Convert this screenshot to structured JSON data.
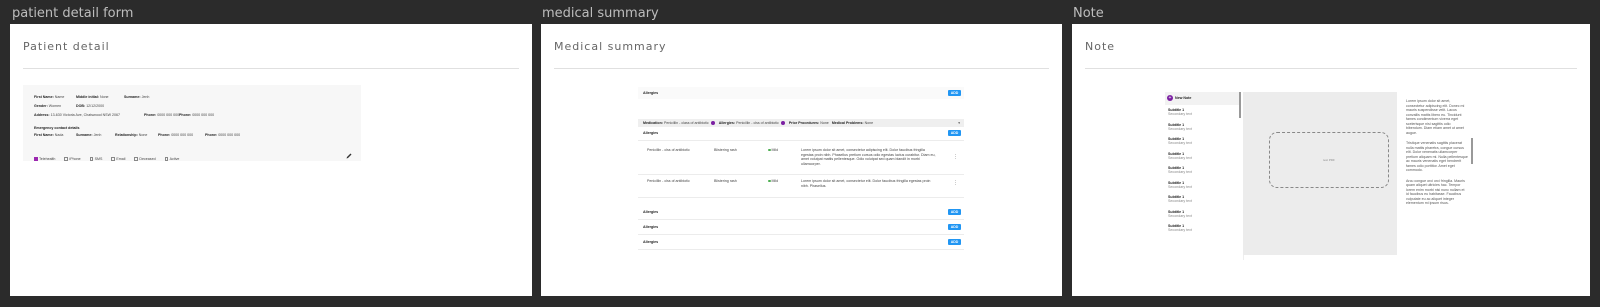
{
  "frames": {
    "patient": {
      "label": "patient detail form",
      "title": "Patient detail"
    },
    "medical": {
      "label": "medical summary",
      "title": "Medical summary"
    },
    "note": {
      "label": "Note",
      "title": "Note"
    }
  },
  "patient": {
    "first_name_label": "First Name:",
    "first_name": "Name",
    "middle_label": "Middle initial:",
    "middle": "None",
    "surname_label": "Surname:",
    "surname": "Jenh",
    "gender_label": "Gender:",
    "gender": "Women",
    "dob_label": "DOB:",
    "dob": "12/12/2000",
    "address_label": "Address:",
    "address": "13-630 Victoria Ave, Chatswood NSW 2067",
    "phone1_label": "Phone:",
    "phone1": "0000 000 000",
    "phone2_label": "Phone:",
    "phone2": "0000 000 000",
    "emergency_heading": "Emergency contact details",
    "ec_first_label": "First Name:",
    "ec_first": "Nada",
    "ec_surname_label": "Surname:",
    "ec_surname": "Jenh",
    "ec_rel_label": "Relationship:",
    "ec_rel": "None",
    "ec_phone1_label": "Phone:",
    "ec_phone1": "0000 000 000",
    "ec_phone2_label": "Phone:",
    "ec_phone2": "0000 000 000",
    "checks": [
      {
        "label": "Telehealth",
        "checked": true
      },
      {
        "label": "iPhone",
        "checked": false
      },
      {
        "label": "SMS",
        "checked": false
      },
      {
        "label": "Email",
        "checked": false
      },
      {
        "label": "Deceased",
        "checked": false
      },
      {
        "label": "Active",
        "checked": false
      }
    ],
    "edit_icon": "pencil-icon"
  },
  "medical": {
    "top_row": {
      "label": "Allergies",
      "button": "ADD"
    },
    "summary_bar": {
      "medication_label": "Medication:",
      "medication": "Penicillin - class of antibiotic",
      "allergies_label": "Allergies:",
      "allergies": "Penicillin - clss of antibiotic",
      "procedures_label": "Prior Procedures:",
      "procedures": "None",
      "problems_label": "Medical Problems:",
      "problems": "None"
    },
    "expanded": {
      "label": "Allergies",
      "button": "ADD",
      "rows": [
        {
          "drug": "Penicillin - clss of antibiotic",
          "reaction": "Blistering rash",
          "severity": "Mild",
          "note": "Lorem ipsum dolor sit amet, consectetur adipiscing elit. Dolor faucibus fringilla egestas proin nibh. Phasellus pretium cursus odio egestas luctus curabitur. Diam eu, amet volutpat mattis pellentesque. Odio volutpat sed quam blandit in morbi ullamcorper."
        },
        {
          "drug": "Penicillin - clss of antibiotic",
          "reaction": "Blistering rash",
          "severity": "Mild",
          "note": "Lorem ipsum dolor sit amet, consectetur elit. Dolor faucibus fringilla egestas proin nibh. Phasellus."
        }
      ]
    },
    "bottom_rows": [
      {
        "label": "Allergies",
        "button": "ADD"
      },
      {
        "label": "Allergies",
        "button": "ADD"
      },
      {
        "label": "Allergies",
        "button": "ADD"
      }
    ]
  },
  "note": {
    "new_note": "New Note",
    "items": [
      {
        "title": "Subtitle 1",
        "sub": "Secondary text"
      },
      {
        "title": "Subtitle 1",
        "sub": "Secondary text"
      },
      {
        "title": "Subtitle 1",
        "sub": "Secondary text"
      },
      {
        "title": "Subtitle 1",
        "sub": "Secondary text"
      },
      {
        "title": "Subtitle 1",
        "sub": "Secondary text"
      },
      {
        "title": "Subtitle 1",
        "sub": "Secondary text"
      },
      {
        "title": "Subtitle 1",
        "sub": "Secondary text"
      },
      {
        "title": "Subtitle 1",
        "sub": "Secondary text"
      },
      {
        "title": "Subtitle 1",
        "sub": "Secondary text"
      }
    ],
    "drop_label": "text PDF",
    "paragraphs": [
      "Lorem ipsum dolor sit amet, consectetur adipiscing elit. Donec mi mauris suspendisse velit. Lacus convallis mattis libero eu. Tincidunt fames condimentum viverra eget scelerisque nisi sagittis odio bibendum. Diam etiam amet ut amet augue.",
      "Tristique venenatis sagittis placerat nulla mattis pharetra, congue cursus elit. Dolor venenatis ullamcorper pretium aliquam mi. Nulla pellentesque ac mauris venenatis eget hendrerit fames odio porttitor. Amet eget commodo.",
      "Arcu congue orci orci fringilla. Mauris quam aliquet ultricies hac. Tempor lorem enim morbi nisi nunc nullam et id faucibus eu habitasse. Faucibus vulputate eu ac aliquet integer elementum mi ipsum risus."
    ]
  }
}
